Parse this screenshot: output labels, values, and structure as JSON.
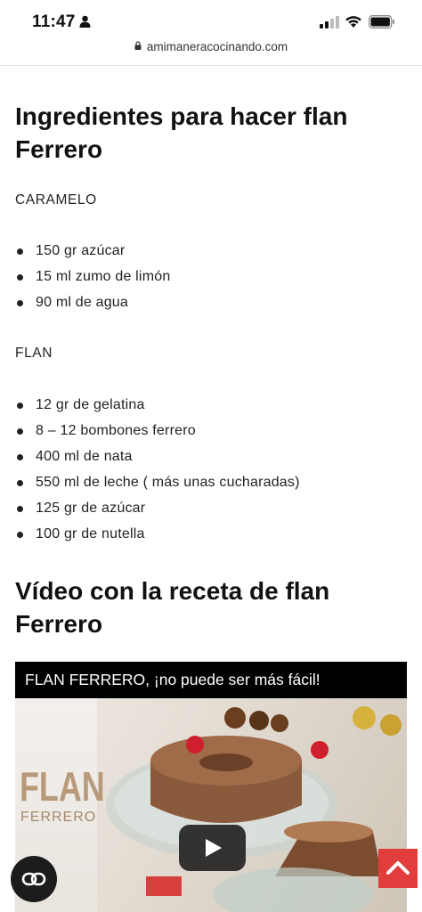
{
  "status_bar": {
    "time": "11:47",
    "icons": [
      "person-icon",
      "signal-icon",
      "wifi-icon",
      "battery-icon"
    ]
  },
  "browser": {
    "url": "amimaneracocinando.com",
    "lock_icon": "lock-icon"
  },
  "article": {
    "heading_ingredients": "Ingredientes para hacer flan Ferrero",
    "caramel_label": "CARAMELO",
    "caramel_items": [
      "150 gr azúcar",
      "15 ml zumo de limón",
      "90 ml de agua"
    ],
    "flan_label": "FLAN",
    "flan_items": [
      "12 gr de gelatina",
      "8 – 12 bombones ferrero",
      "400 ml de nata",
      "550 ml de leche ( más unas cucharadas)",
      "125 gr de azúcar",
      "100 gr de nutella"
    ],
    "heading_video": "Vídeo con la receta de flan Ferrero"
  },
  "video": {
    "title": "FLAN FERRERO, ¡no puede ser más fácil!",
    "thumb_title": "FLAN",
    "thumb_subtitle": "FERRERO"
  },
  "floating": {
    "left_button_icon": "link-icon",
    "right_button_icon": "chevron-up-icon"
  },
  "colors": {
    "scroll_top_button": "#e23d3d",
    "fab_dark": "#1c1c1c"
  }
}
